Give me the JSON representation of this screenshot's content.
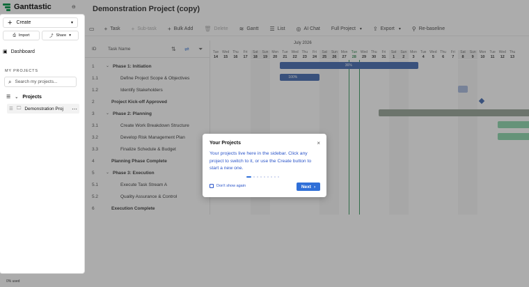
{
  "app": {
    "name": "Ganttastic",
    "project_title": "Demonstration Project (copy)",
    "usage": "0% used"
  },
  "toolbar": {
    "items": [
      {
        "label": "Task",
        "icon": "plus-icon",
        "enabled": true
      },
      {
        "label": "Sub-task",
        "icon": "plus-icon",
        "enabled": false
      },
      {
        "label": "Bulk Add",
        "icon": "plus-icon",
        "enabled": true
      },
      {
        "label": "Delete",
        "icon": "trash-icon",
        "enabled": false
      },
      {
        "label": "Gantt",
        "icon": "gantt-icon",
        "enabled": true
      },
      {
        "label": "List",
        "icon": "list-icon",
        "enabled": true
      },
      {
        "label": "AI Chat",
        "icon": "chat-icon",
        "enabled": true
      },
      {
        "label": "Full Project",
        "icon": "",
        "enabled": true,
        "dropdown": true
      },
      {
        "label": "Export",
        "icon": "export-icon",
        "enabled": true,
        "dropdown": true
      },
      {
        "label": "Re-baseline",
        "icon": "baseline-icon",
        "enabled": true
      }
    ]
  },
  "grid": {
    "col_id": "ID",
    "col_name": "Task Name",
    "rows": [
      {
        "id": "1",
        "name": "Phase 1: Initiation",
        "bold": true,
        "toggle": true,
        "indent": 0
      },
      {
        "id": "1.1",
        "name": "Define Project Scope & Objectives",
        "bold": false,
        "toggle": false,
        "indent": 1
      },
      {
        "id": "1.2",
        "name": "Identify Stakeholders",
        "bold": false,
        "toggle": false,
        "indent": 1
      },
      {
        "id": "2",
        "name": "Project Kick-off Approved",
        "bold": true,
        "toggle": false,
        "indent": 0
      },
      {
        "id": "3",
        "name": "Phase 2: Planning",
        "bold": true,
        "toggle": true,
        "indent": 0
      },
      {
        "id": "3.1",
        "name": "Create Work Breakdown Structure",
        "bold": false,
        "toggle": false,
        "indent": 1
      },
      {
        "id": "3.2",
        "name": "Develop Risk Management Plan",
        "bold": false,
        "toggle": false,
        "indent": 1
      },
      {
        "id": "3.3",
        "name": "Finalize Schedule & Budget",
        "bold": false,
        "toggle": false,
        "indent": 1
      },
      {
        "id": "4",
        "name": "Planning Phase Complete",
        "bold": true,
        "toggle": false,
        "indent": 0
      },
      {
        "id": "5",
        "name": "Phase 3: Execution",
        "bold": true,
        "toggle": true,
        "indent": 0
      },
      {
        "id": "5.1",
        "name": "Execute Task Stream A",
        "bold": false,
        "toggle": false,
        "indent": 1
      },
      {
        "id": "5.2",
        "name": "Quality Assurance & Control",
        "bold": false,
        "toggle": false,
        "indent": 1
      },
      {
        "id": "6",
        "name": "Execution Complete",
        "bold": true,
        "toggle": false,
        "indent": 0
      }
    ]
  },
  "gantt": {
    "month": "July 2026",
    "days": [
      {
        "dw": "Tue",
        "dn": "14"
      },
      {
        "dw": "Wed",
        "dn": "15"
      },
      {
        "dw": "Thu",
        "dn": "16"
      },
      {
        "dw": "Fri",
        "dn": "17"
      },
      {
        "dw": "Sat",
        "dn": "18",
        "weekend": true
      },
      {
        "dw": "Sun",
        "dn": "19",
        "weekend": true
      },
      {
        "dw": "Mon",
        "dn": "20"
      },
      {
        "dw": "Tue",
        "dn": "21"
      },
      {
        "dw": "Wed",
        "dn": "22"
      },
      {
        "dw": "Thu",
        "dn": "23"
      },
      {
        "dw": "Fri",
        "dn": "24"
      },
      {
        "dw": "Sat",
        "dn": "25",
        "weekend": true
      },
      {
        "dw": "Sun",
        "dn": "26",
        "weekend": true
      },
      {
        "dw": "Mon",
        "dn": "27"
      },
      {
        "dw": "Tue",
        "dn": "28",
        "today": true
      },
      {
        "dw": "Wed",
        "dn": "29"
      },
      {
        "dw": "Thu",
        "dn": "30"
      },
      {
        "dw": "Fri",
        "dn": "31"
      },
      {
        "dw": "Sat",
        "dn": "1",
        "weekend": true
      },
      {
        "dw": "Sun",
        "dn": "2",
        "weekend": true
      },
      {
        "dw": "Mon",
        "dn": "3"
      },
      {
        "dw": "Tue",
        "dn": "4"
      },
      {
        "dw": "Wed",
        "dn": "5"
      },
      {
        "dw": "Thu",
        "dn": "6"
      },
      {
        "dw": "Fri",
        "dn": "7"
      },
      {
        "dw": "Sat",
        "dn": "8",
        "weekend": true
      },
      {
        "dw": "Sun",
        "dn": "9",
        "weekend": true
      },
      {
        "dw": "Mon",
        "dn": "10"
      },
      {
        "dw": "Tue",
        "dn": "11"
      },
      {
        "dw": "Wed",
        "dn": "12"
      },
      {
        "dw": "Thu",
        "dn": "13"
      }
    ],
    "bars": [
      {
        "row": 0,
        "start": 7,
        "span": 14,
        "label": "36%",
        "color": "#2e5aa8"
      },
      {
        "row": 1,
        "start": 7,
        "span": 4,
        "label": "100%",
        "color": "#2e5aa8"
      },
      {
        "row": 2,
        "start": 25,
        "span": 1,
        "label": "",
        "color": "#9fb3da"
      },
      {
        "row": 4,
        "start": 17,
        "span": 16,
        "label": "",
        "color": "#8a9a8a"
      },
      {
        "row": 5,
        "start": 29,
        "span": 4,
        "label": "",
        "color": "#7fd1a3"
      },
      {
        "row": 6,
        "start": 29,
        "span": 4,
        "label": "",
        "color": "#7fd1a3"
      }
    ],
    "milestones": [
      {
        "row": 3,
        "day": 27
      }
    ],
    "accent_today": "#1f8a4c"
  },
  "sidebar": {
    "create_label": "Create",
    "import_label": "Import",
    "share_label": "Share",
    "dashboard_label": "Dashboard",
    "section_label": "MY PROJECTS",
    "search_placeholder": "Search my projects...",
    "projects_label": "Projects",
    "project_item": "Demonstration Proj"
  },
  "popover": {
    "title": "Your Projects",
    "body": "Your projects live here in the sidebar. Click any project to switch to it, or use the Create button to start a new one.",
    "checkbox_label": "Don't show again",
    "next_label": "Next",
    "steps_total": 9,
    "step_current": 1
  }
}
